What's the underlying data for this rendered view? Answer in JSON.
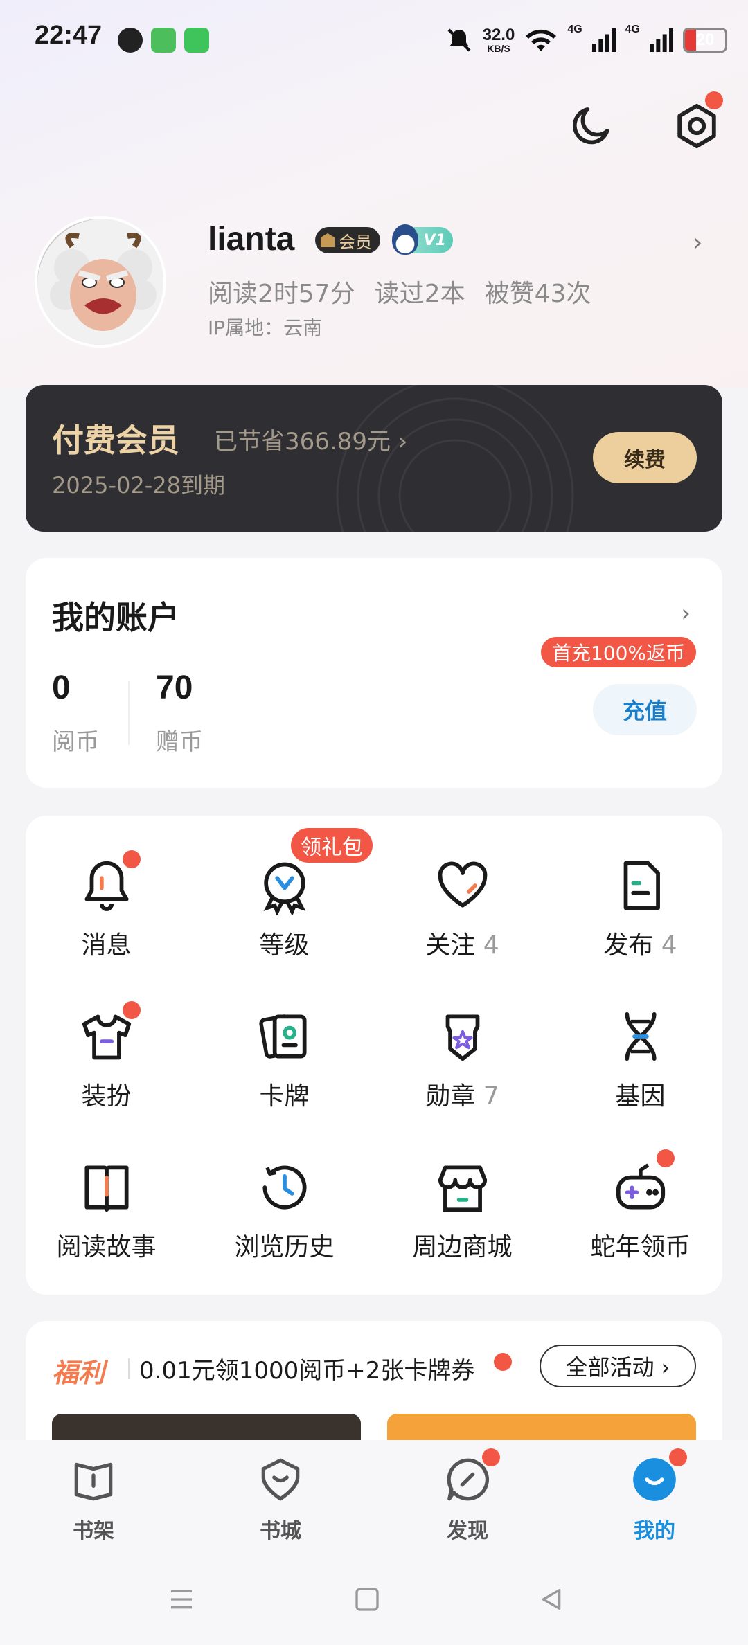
{
  "status_bar": {
    "time": "22:47",
    "speed_value": "32.0",
    "speed_unit": "KB/S",
    "net1": "4G",
    "net2": "4G",
    "battery": "20"
  },
  "profile": {
    "username": "lianta",
    "vip_badge": "会员",
    "level_badge": "V1",
    "stats": [
      "阅读2时57分",
      "读过2本",
      "被赞43次"
    ],
    "ip_location": "IP属地：云南"
  },
  "vip_card": {
    "title": "付费会员",
    "saved": "已节省366.89元 ›",
    "expire": "2025-02-28到期",
    "renew_label": "续费"
  },
  "account": {
    "title": "我的账户",
    "coins": {
      "value": "0",
      "label": "阅币"
    },
    "gift_coins": {
      "value": "70",
      "label": "赠币"
    },
    "promo": "首充100%返币",
    "recharge_label": "充值"
  },
  "menu": {
    "gift_badge": "领礼包",
    "items": [
      {
        "label": "消息",
        "count": "",
        "icon": "bell-icon"
      },
      {
        "label": "等级",
        "count": "",
        "icon": "level-icon"
      },
      {
        "label": "关注",
        "count": "4",
        "icon": "heart-icon"
      },
      {
        "label": "发布",
        "count": "4",
        "icon": "document-icon"
      },
      {
        "label": "装扮",
        "count": "",
        "icon": "tshirt-icon"
      },
      {
        "label": "卡牌",
        "count": "",
        "icon": "cards-icon"
      },
      {
        "label": "勋章",
        "count": "7",
        "icon": "medal-icon"
      },
      {
        "label": "基因",
        "count": "",
        "icon": "dna-icon"
      },
      {
        "label": "阅读故事",
        "count": "",
        "icon": "book-icon"
      },
      {
        "label": "浏览历史",
        "count": "",
        "icon": "clock-icon"
      },
      {
        "label": "周边商城",
        "count": "",
        "icon": "shop-icon"
      },
      {
        "label": "蛇年领币",
        "count": "",
        "icon": "gamepad-icon"
      }
    ]
  },
  "welfare": {
    "title": "福利",
    "text": "0.01元领1000阅币+2张卡牌券",
    "all_label": "全部活动 ›"
  },
  "tabbar": {
    "items": [
      {
        "label": "书架",
        "icon": "bookshelf-icon"
      },
      {
        "label": "书城",
        "icon": "bookstore-icon"
      },
      {
        "label": "发现",
        "icon": "compass-icon"
      },
      {
        "label": "我的",
        "icon": "profile-icon"
      }
    ]
  },
  "colors": {
    "accent_red": "#f25745",
    "gold": "#eccf9c",
    "active_blue": "#1a8fe0"
  }
}
